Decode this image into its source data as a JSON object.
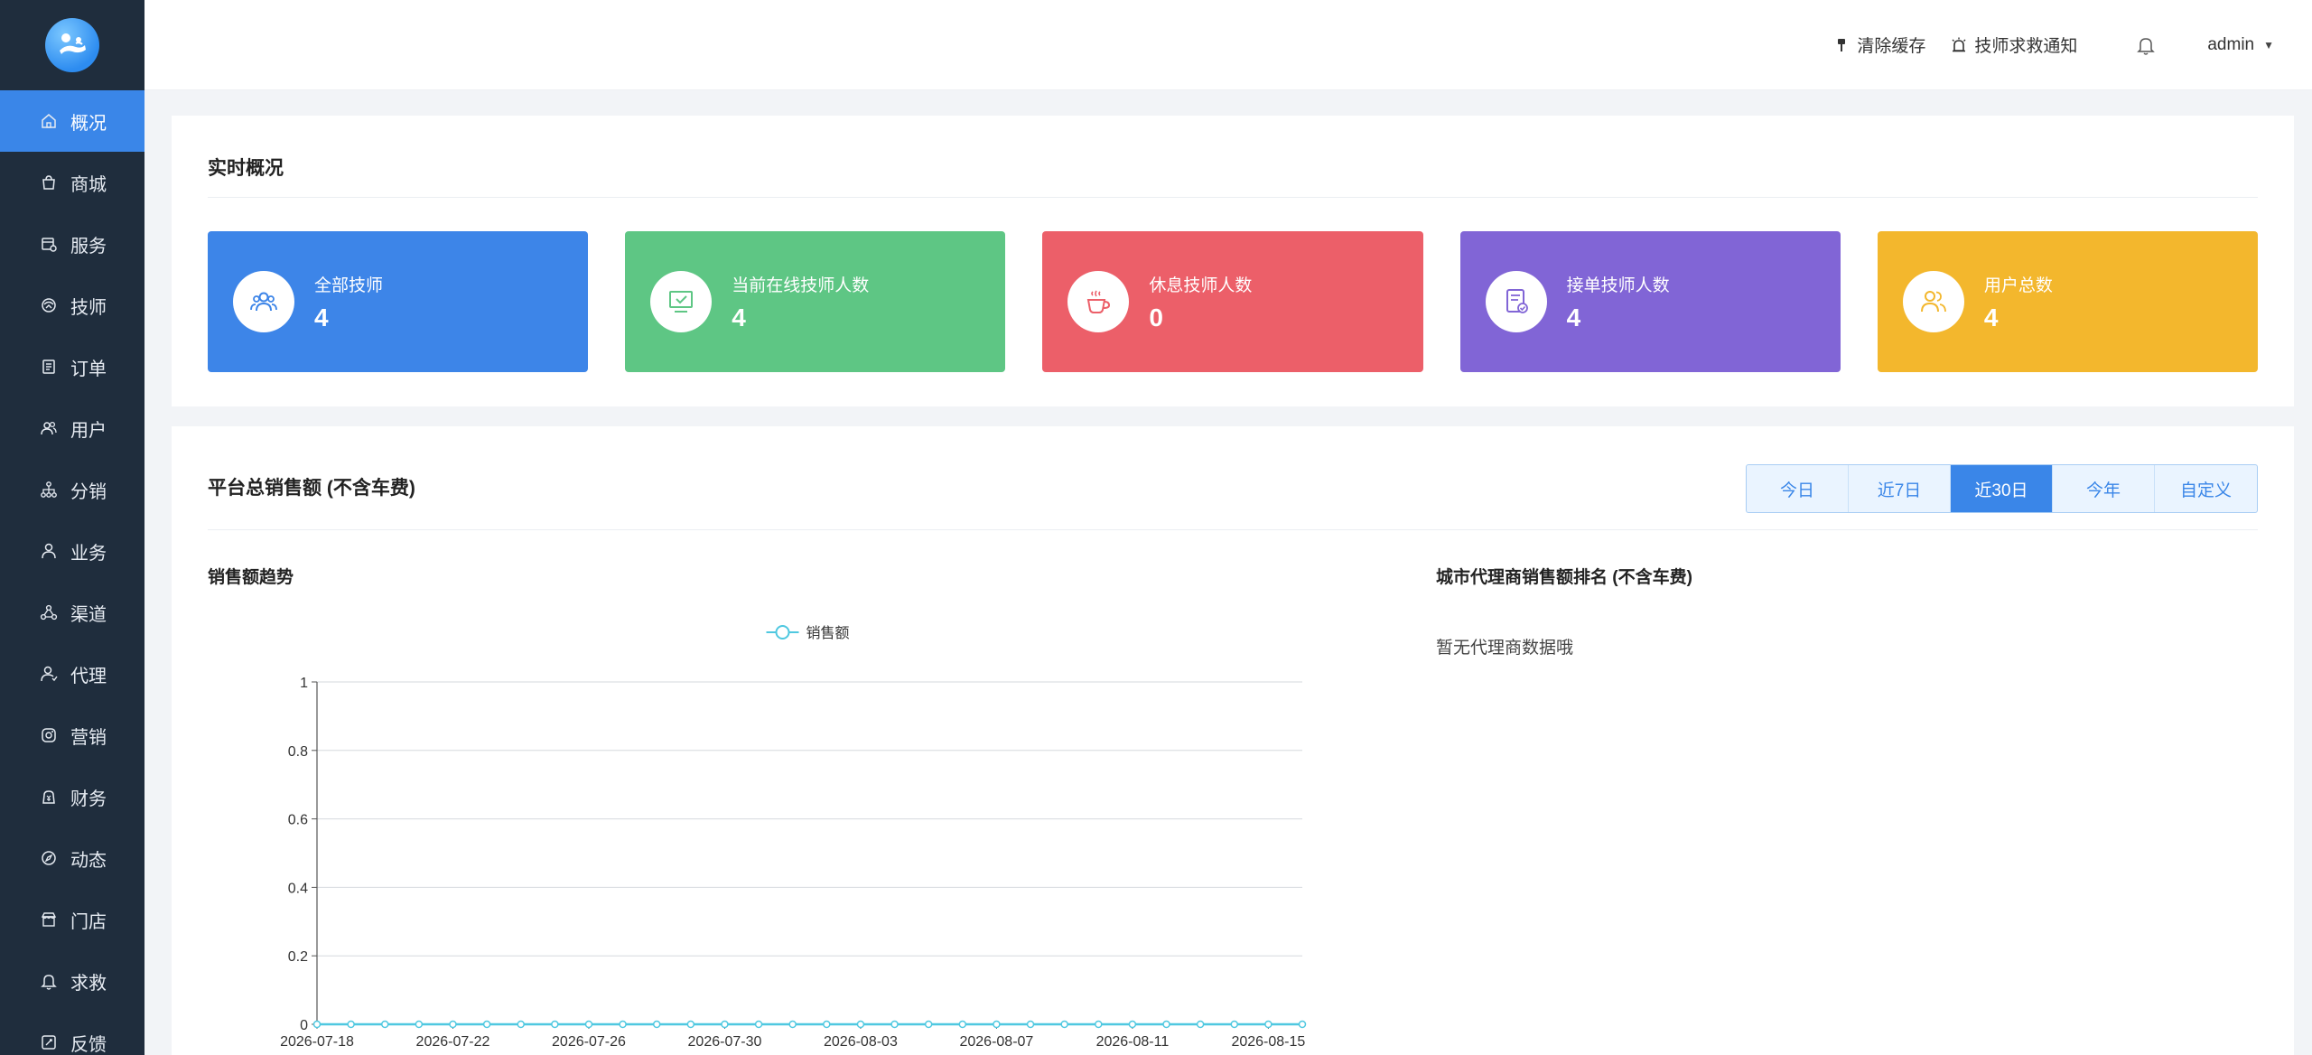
{
  "sidebar": {
    "items": [
      {
        "label": "概况",
        "icon": "home-icon",
        "active": true
      },
      {
        "label": "商城",
        "icon": "shopping-bag-icon"
      },
      {
        "label": "服务",
        "icon": "service-icon"
      },
      {
        "label": "技师",
        "icon": "technician-icon"
      },
      {
        "label": "订单",
        "icon": "order-icon"
      },
      {
        "label": "用户",
        "icon": "users-icon"
      },
      {
        "label": "分销",
        "icon": "distribution-icon"
      },
      {
        "label": "业务",
        "icon": "business-icon"
      },
      {
        "label": "渠道",
        "icon": "channel-icon"
      },
      {
        "label": "代理",
        "icon": "agent-icon"
      },
      {
        "label": "营销",
        "icon": "marketing-icon"
      },
      {
        "label": "财务",
        "icon": "finance-icon"
      },
      {
        "label": "动态",
        "icon": "compass-icon"
      },
      {
        "label": "门店",
        "icon": "store-icon"
      },
      {
        "label": "求救",
        "icon": "bell-icon"
      },
      {
        "label": "反馈",
        "icon": "feedback-icon"
      }
    ]
  },
  "header": {
    "clear_cache": "清除缓存",
    "rescue_notice": "技师求救通知",
    "user": "admin"
  },
  "overview": {
    "title": "实时概况",
    "stats": [
      {
        "label": "全部技师",
        "value": "4",
        "color": "#3d85e8",
        "icon": "technicians-group-icon"
      },
      {
        "label": "当前在线技师人数",
        "value": "4",
        "color": "#5ec684",
        "icon": "monitor-check-icon"
      },
      {
        "label": "休息技师人数",
        "value": "0",
        "color": "#ec5f69",
        "icon": "coffee-cup-icon"
      },
      {
        "label": "接单技师人数",
        "value": "4",
        "color": "#8165d6",
        "icon": "order-accept-icon"
      },
      {
        "label": "用户总数",
        "value": "4",
        "color": "#f3b72d",
        "icon": "user-group-icon"
      }
    ]
  },
  "sales": {
    "title": "平台总销售额 (不含车费)",
    "ranges": [
      {
        "label": "今日"
      },
      {
        "label": "近7日"
      },
      {
        "label": "近30日",
        "active": true
      },
      {
        "label": "今年"
      },
      {
        "label": "自定义"
      }
    ],
    "trend_title": "销售额趋势",
    "ranking_title": "城市代理商销售额排名 (不含车费)",
    "ranking_empty": "暂无代理商数据哦"
  },
  "chart_data": {
    "type": "line",
    "title": "",
    "xlabel": "",
    "ylabel": "",
    "ylim": [
      0,
      1
    ],
    "yticks": [
      0,
      0.2,
      0.4,
      0.6,
      0.8,
      1
    ],
    "grid": true,
    "legend_placement": "top-center",
    "x_tick_labels": [
      "2026-07-18",
      "2026-07-22",
      "2026-07-26",
      "2026-07-30",
      "2026-08-03",
      "2026-08-07",
      "2026-08-11",
      "2026-08-15"
    ],
    "x": [
      "2026-07-18",
      "2026-07-19",
      "2026-07-20",
      "2026-07-21",
      "2026-07-22",
      "2026-07-23",
      "2026-07-24",
      "2026-07-25",
      "2026-07-26",
      "2026-07-27",
      "2026-07-28",
      "2026-07-29",
      "2026-07-30",
      "2026-07-31",
      "2026-08-01",
      "2026-08-02",
      "2026-08-03",
      "2026-08-04",
      "2026-08-05",
      "2026-08-06",
      "2026-08-07",
      "2026-08-08",
      "2026-08-09",
      "2026-08-10",
      "2026-08-11",
      "2026-08-12",
      "2026-08-13",
      "2026-08-14",
      "2026-08-15",
      "2026-08-16"
    ],
    "series": [
      {
        "name": "销售额",
        "color": "#4fc8e0",
        "values": [
          0,
          0,
          0,
          0,
          0,
          0,
          0,
          0,
          0,
          0,
          0,
          0,
          0,
          0,
          0,
          0,
          0,
          0,
          0,
          0,
          0,
          0,
          0,
          0,
          0,
          0,
          0,
          0,
          0,
          0
        ]
      }
    ]
  }
}
